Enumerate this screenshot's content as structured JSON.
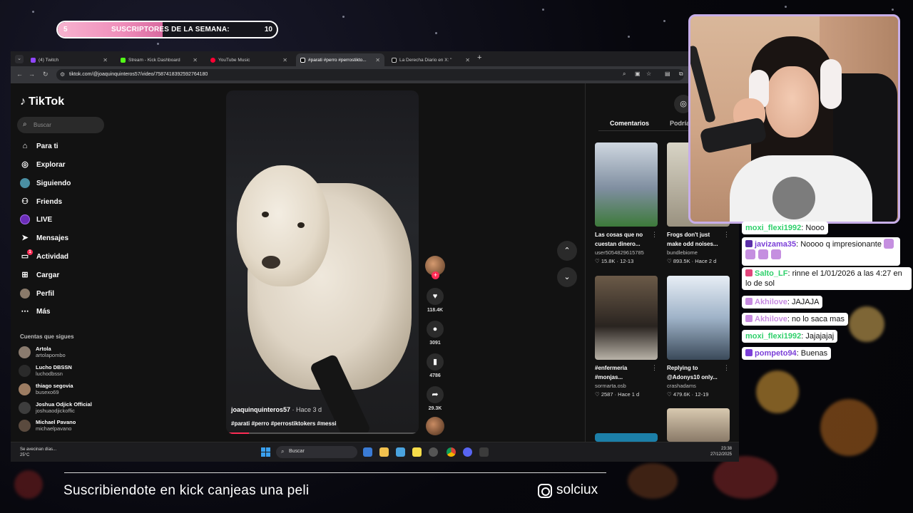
{
  "sub_goal": {
    "current": "5",
    "label": "SUSCRIPTORES DE LA SEMANA:",
    "target": "10",
    "progress_fraction": 0.5
  },
  "browser": {
    "tabs": [
      {
        "label": "(4) Twitch",
        "color": "#9146ff",
        "active": false
      },
      {
        "label": "Stream - Kick Dashboard",
        "color": "#53fc18",
        "active": false
      },
      {
        "label": "YouTube Music",
        "color": "#ff0033",
        "active": false
      },
      {
        "label": "#parati #perro #perrostikto...",
        "color": "#ffffff",
        "active": true
      },
      {
        "label": "La Derecha Diario en X: \"",
        "color": "#ffffff",
        "active": false
      }
    ],
    "url": "tiktok.com/@joaquinquinteros57/video/7587418392592764180"
  },
  "tiktok": {
    "logo": "TikTok",
    "search_placeholder": "Buscar",
    "nav": [
      {
        "label": "Para ti",
        "icon": "home-icon"
      },
      {
        "label": "Explorar",
        "icon": "compass-icon"
      },
      {
        "label": "Siguiendo",
        "icon": "following-avatar-icon"
      },
      {
        "label": "Friends",
        "icon": "friends-icon"
      },
      {
        "label": "LIVE",
        "icon": "live-icon"
      },
      {
        "label": "Mensajes",
        "icon": "messages-icon"
      },
      {
        "label": "Actividad",
        "icon": "activity-icon",
        "badge": "1"
      },
      {
        "label": "Cargar",
        "icon": "upload-icon"
      },
      {
        "label": "Perfil",
        "icon": "profile-icon"
      },
      {
        "label": "Más",
        "icon": "more-icon"
      }
    ],
    "following_title": "Cuentas que sigues",
    "following": [
      {
        "name": "Artola",
        "handle": "artolapombo"
      },
      {
        "name": "Lucho DBSSN",
        "handle": "luchodbssn"
      },
      {
        "name": "thiago segovia",
        "handle": "busexo69"
      },
      {
        "name": "Joshua Odjick Official",
        "handle": "joshuaodjickoffic"
      },
      {
        "name": "Michael Pavano",
        "handle": "michaelpavano"
      }
    ],
    "video": {
      "author": "joaquinquinteros57",
      "ago": " · Hace 3 d",
      "tags": "#parati #perro #perrostiktokers #messi"
    },
    "actions": {
      "likes": "118.4K",
      "comments": "3091",
      "saves": "4786",
      "shares": "29.3K"
    },
    "right_panel": {
      "tab_comments": "Comentarios",
      "tab_more": "Podría",
      "cards": [
        {
          "caption1": "Las cosas que no",
          "caption2": "cuestan dinero...",
          "user": "user5054829615785",
          "views": "15.8K",
          "date": "12-13"
        },
        {
          "caption1": "Frogs don't just",
          "caption2": "make odd noises...",
          "user": "bundlebiome",
          "views": "893.5K",
          "date": "Hace 2 d"
        },
        {
          "caption1": "#enfermeria",
          "caption2": "#monjas...",
          "user": "sormarta.osb",
          "views": "2587",
          "date": "Hace 1 d"
        },
        {
          "caption1": "Replying to",
          "caption2": "@Adonys10 only...",
          "user": "crashadams",
          "views": "479.6K",
          "date": "12-19"
        }
      ]
    }
  },
  "taskbar": {
    "weather_line1": "Se avecinan días...",
    "weather_line2": "25°C",
    "search_placeholder": "Buscar",
    "time": "23:38",
    "date": "27/12/2025"
  },
  "chat": [
    {
      "user": "moxi_flexi1992",
      "text": ": Nooo",
      "user_color": "#2fd06b"
    },
    {
      "user": "javizama35",
      "text": ": Noooo q impresionante",
      "user_color": "#7b3fd8"
    },
    {
      "user": "Salto_LF",
      "text": ": rinne el 1/01/2026 a las 4:27 en lo de sol",
      "user_color": "#2fd06b"
    },
    {
      "user": "Akhilove",
      "text": ": JAJAJA",
      "user_color": "#c78be0"
    },
    {
      "user": "Akhilove",
      "text": ": no lo saca mas",
      "user_color": "#c78be0"
    },
    {
      "user": "moxi_flexi1992",
      "text": ": Jajajajaj",
      "user_color": "#2fd06b"
    },
    {
      "user": "pompeto94",
      "text": ": Buenas",
      "user_color": "#7b3fd8"
    }
  ],
  "footer": {
    "text": "Suscribiendote en kick canjeas una peli",
    "instagram": "solciux"
  }
}
